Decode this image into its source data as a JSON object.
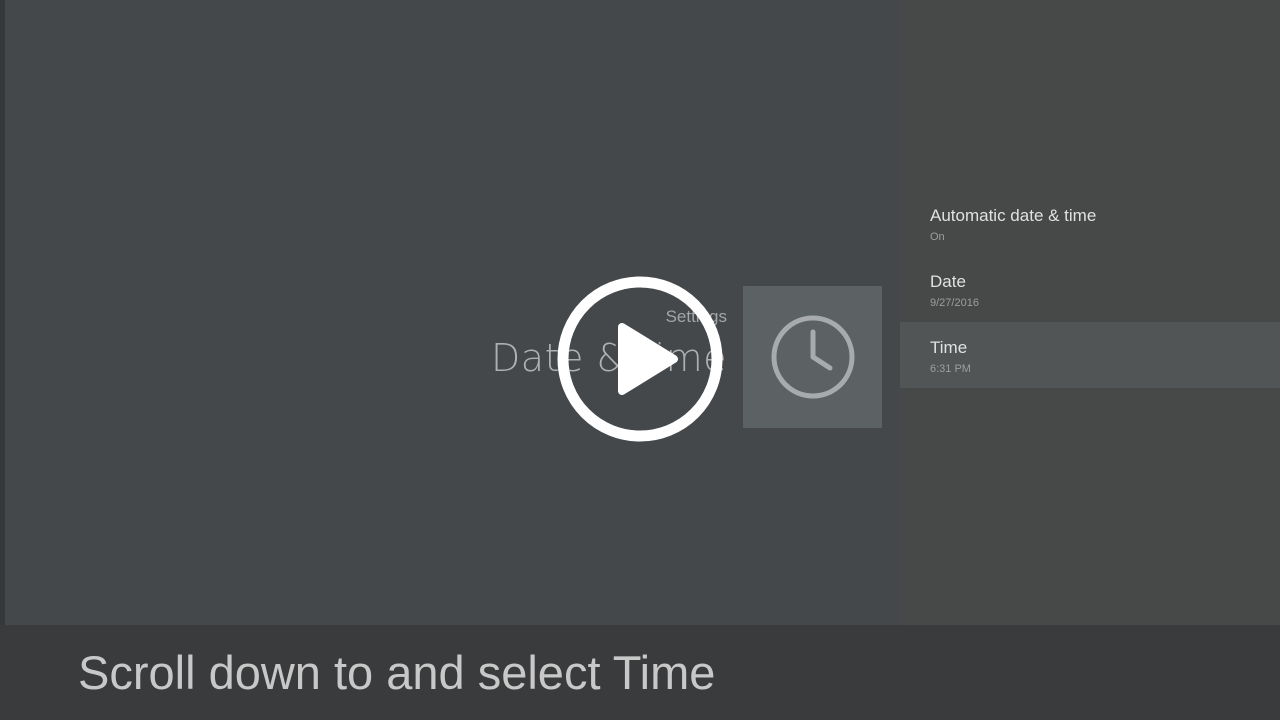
{
  "header": {
    "breadcrumb": "Settings",
    "title": "Date & time",
    "icon": "clock-icon"
  },
  "menu": {
    "items": [
      {
        "title": "Automatic date & time",
        "subtitle": "On",
        "selected": false
      },
      {
        "title": "Date",
        "subtitle": "9/27/2016",
        "selected": false
      },
      {
        "title": "Time",
        "subtitle": "6:31 PM",
        "selected": true
      }
    ]
  },
  "overlay": {
    "play_icon": "play-icon"
  },
  "caption": {
    "text": "Scroll down to and select Time"
  },
  "colors": {
    "background": "#45484b",
    "panel": "#474948",
    "selected_row": "#525556",
    "caption_bar": "#3a3b3c",
    "play_ring": "#ffffff"
  }
}
